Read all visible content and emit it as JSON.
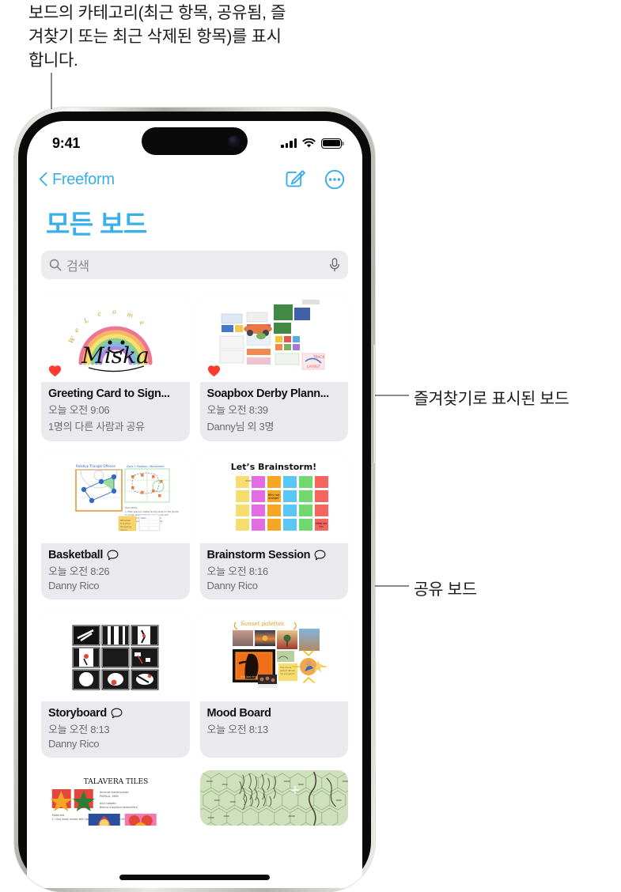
{
  "annotations": {
    "top_note": "보드의 카테고리(최근 항목, 공유됨, 즐겨찾기 또는 최근 삭제된 항목)를 표시합니다.",
    "favorite_label": "즐겨찾기로 표시된 보드",
    "shared_label": "공유 보드"
  },
  "statusbar": {
    "time": "9:41",
    "cellular_icon": "signal-bars-icon",
    "wifi_icon": "wifi-icon",
    "battery_icon": "battery-icon"
  },
  "navbar": {
    "back_label": "Freeform",
    "back_icon": "chevron-left-icon",
    "compose_icon": "compose-icon",
    "more_icon": "ellipsis-circle-icon"
  },
  "header": {
    "title": "모든 보드",
    "title_color": "#3bb0e8"
  },
  "search": {
    "placeholder": "검색",
    "search_icon": "search-icon",
    "mic_icon": "microphone-icon"
  },
  "boards": [
    {
      "name": "Greeting Card to Sign...",
      "time": "오늘 오전 9:06",
      "detail": "1명의 다른 사람과 공유",
      "favorite": true,
      "shared_comment": false,
      "thumb": "greeting-card-rainbow-miska"
    },
    {
      "name": "Soapbox Derby Plann...",
      "time": "오늘 오전 8:39",
      "detail": "Danny님 외 3명",
      "favorite": true,
      "shared_comment": false,
      "thumb": "soapbox-derby-planning-collage"
    },
    {
      "name": "Basketball",
      "time": "오늘 오전 8:26",
      "detail": "Danny Rico",
      "favorite": false,
      "shared_comment": true,
      "thumb": "basketball-court-diagram"
    },
    {
      "name": "Brainstorm Session",
      "time": "오늘 오전 8:16",
      "detail": "Danny Rico",
      "favorite": false,
      "shared_comment": true,
      "thumb": "brainstorm-sticky-notes"
    },
    {
      "name": "Storyboard",
      "time": "오늘 오전 8:13",
      "detail": "Danny Rico",
      "favorite": false,
      "shared_comment": true,
      "thumb": "storyboard-sketch-grid"
    },
    {
      "name": "Mood Board",
      "time": "오늘 오전 8:13",
      "detail": "",
      "favorite": false,
      "shared_comment": false,
      "thumb": "mood-board-sunset-palettes"
    }
  ],
  "partial_boards": [
    {
      "thumb": "talavera-tiles-board",
      "caption": "TALAVERA TILES"
    },
    {
      "thumb": "hex-map-board",
      "caption": ""
    }
  ],
  "colors": {
    "accent": "#3bb0e8",
    "card_bg": "#e9e9ee",
    "search_bg": "#ececee",
    "heart": "#ff3b30"
  }
}
